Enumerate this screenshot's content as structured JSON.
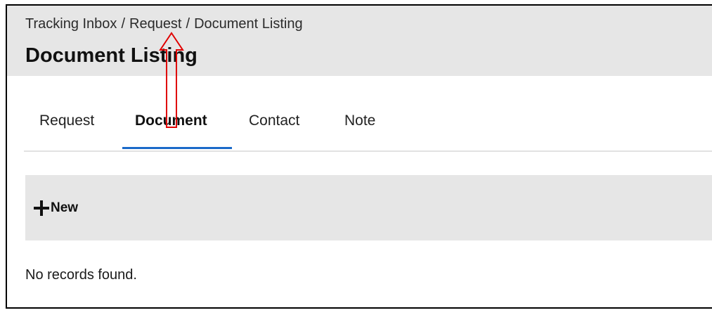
{
  "breadcrumb": {
    "items": [
      "Tracking Inbox",
      "Request",
      "Document Listing"
    ],
    "separator": "/"
  },
  "page": {
    "title": "Document Listing"
  },
  "tabs": [
    {
      "label": "Request",
      "active": false
    },
    {
      "label": "Document",
      "active": true
    },
    {
      "label": "Contact",
      "active": false
    },
    {
      "label": "Note",
      "active": false
    }
  ],
  "toolbar": {
    "new_label": "New",
    "new_icon": "plus-icon"
  },
  "listing": {
    "empty_message": "No records found."
  },
  "colors": {
    "header_bg": "#e6e6e6",
    "toolbar_bg": "#e6e6e6",
    "active_tab_underline": "#1b6ac9",
    "annotation_arrow": "#e00000"
  }
}
